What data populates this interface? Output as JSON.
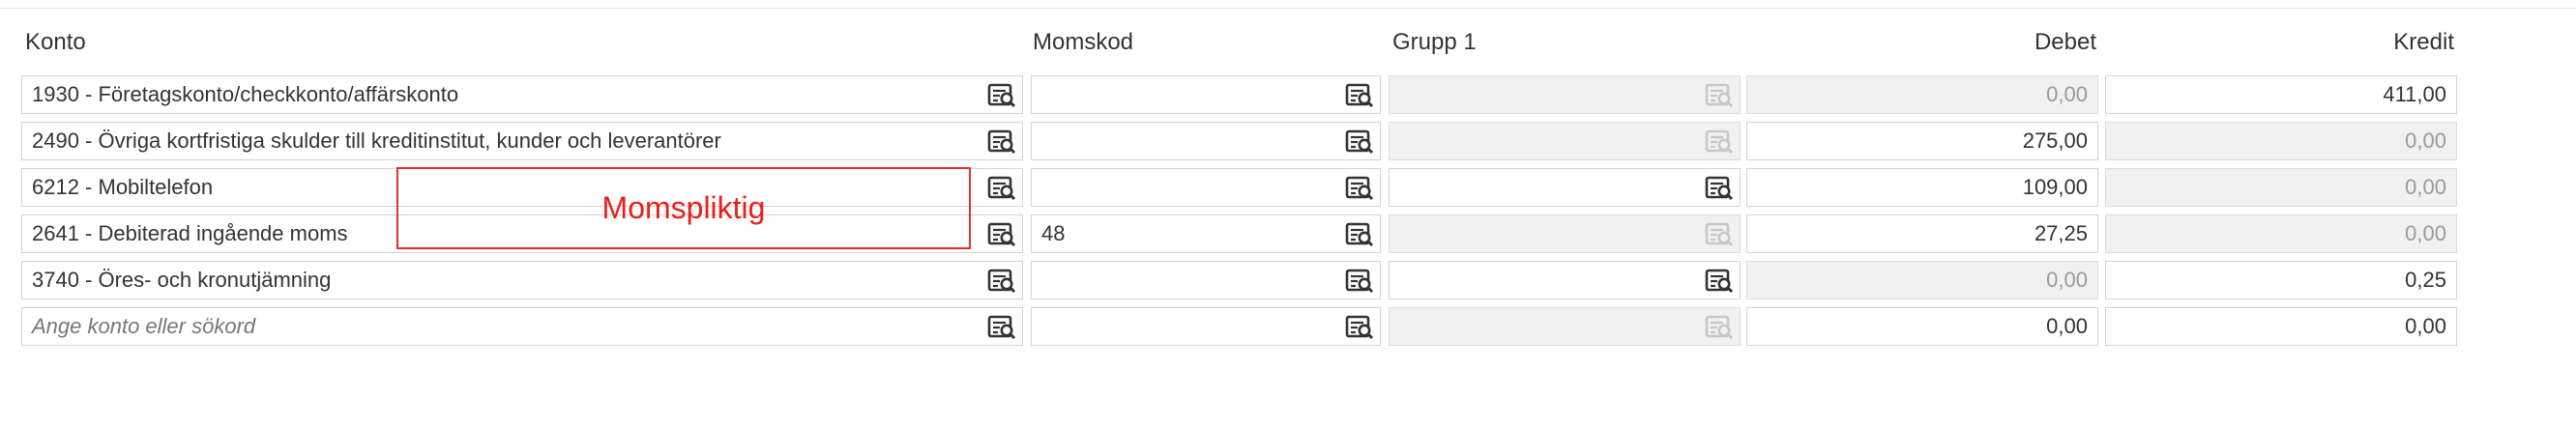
{
  "columns": {
    "konto": "Konto",
    "momskod": "Momskod",
    "grupp1": "Grupp 1",
    "debet": "Debet",
    "kredit": "Kredit"
  },
  "rows": [
    {
      "konto": "1930 - Företagskonto/checkkonto/affärskonto",
      "momskod": "",
      "grupp_enabled": false,
      "debet": "0,00",
      "debet_enabled": false,
      "kredit": "411,00",
      "kredit_enabled": true
    },
    {
      "konto": "2490 - Övriga kortfristiga skulder till kreditinstitut, kunder och leverantörer",
      "momskod": "",
      "grupp_enabled": false,
      "debet": "275,00",
      "debet_enabled": true,
      "kredit": "0,00",
      "kredit_enabled": false
    },
    {
      "konto": "6212 - Mobiltelefon",
      "momskod": "",
      "grupp_enabled": true,
      "debet": "109,00",
      "debet_enabled": true,
      "kredit": "0,00",
      "kredit_enabled": false
    },
    {
      "konto": "2641 - Debiterad ingående moms",
      "momskod": "48",
      "grupp_enabled": false,
      "debet": "27,25",
      "debet_enabled": true,
      "kredit": "0,00",
      "kredit_enabled": false
    },
    {
      "konto": "3740 - Öres- och kronutjämning",
      "momskod": "",
      "grupp_enabled": true,
      "debet": "0,00",
      "debet_enabled": false,
      "kredit": "0,25",
      "kredit_enabled": true
    },
    {
      "konto": "",
      "konto_placeholder": "Ange konto eller sökord",
      "momskod": "",
      "grupp_enabled": false,
      "debet": "0,00",
      "debet_enabled": true,
      "kredit": "0,00",
      "kredit_enabled": true
    }
  ],
  "annotation": {
    "label": "Momspliktig",
    "color": "#e8201c"
  },
  "icons": {
    "lookup": "search-list-icon"
  }
}
